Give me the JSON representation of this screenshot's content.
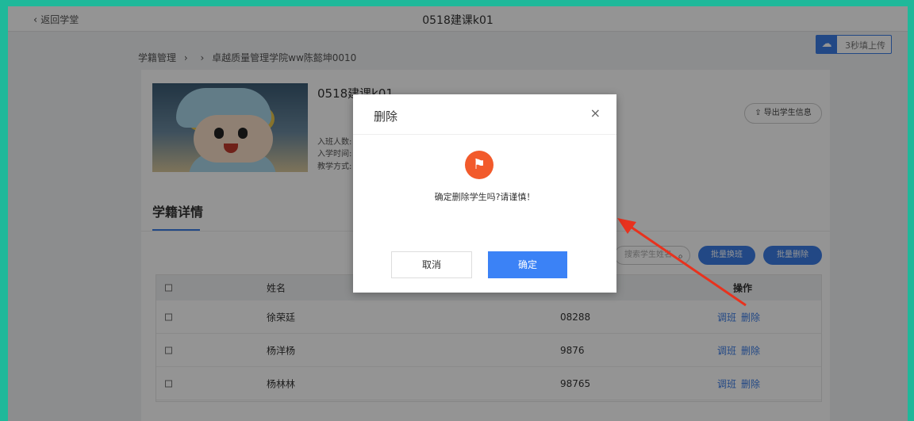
{
  "header": {
    "back_label": "返回学堂",
    "title": "0518建课k01"
  },
  "baidu_badge": {
    "label": "3秒填上传"
  },
  "breadcrumb": {
    "items": [
      "学籍管理",
      "卓越质量管理学院ww陈懿坤0010"
    ],
    "separators": [
      "›",
      "›"
    ]
  },
  "class_card": {
    "name": "0518建课k01",
    "meta": [
      "入班人数:",
      "入学时间:",
      "教学方式:"
    ],
    "export_label": "导出学生信息"
  },
  "section": {
    "title": "学籍详情",
    "search_placeholder": "搜索学生姓名",
    "batch_transfer": "批量换班",
    "batch_delete": "批量删除"
  },
  "table": {
    "headers": {
      "name": "姓名",
      "ops": "操作"
    },
    "rows": [
      {
        "name": "徐荣廷",
        "id": "08288",
        "op_transfer": "调班",
        "op_delete": "删除"
      },
      {
        "name": "杨洋杨",
        "id": "9876",
        "op_transfer": "调班",
        "op_delete": "删除"
      },
      {
        "name": "杨林林",
        "id": "98765",
        "op_transfer": "调班",
        "op_delete": "删除"
      }
    ]
  },
  "modal": {
    "title": "删除",
    "close_glyph": "×",
    "message": "确定删除学生吗?请谨慎！",
    "cancel_label": "取消",
    "confirm_label": "确定"
  },
  "colors": {
    "accent": "#3b7ce6",
    "warning": "#f25a2b",
    "frame": "#1fb89a",
    "annotation_arrow": "#e8321e"
  },
  "icons": [
    "chevron-left-icon",
    "baidu-cloud-icon",
    "upload-icon",
    "search-icon",
    "warning-icon",
    "close-icon"
  ]
}
